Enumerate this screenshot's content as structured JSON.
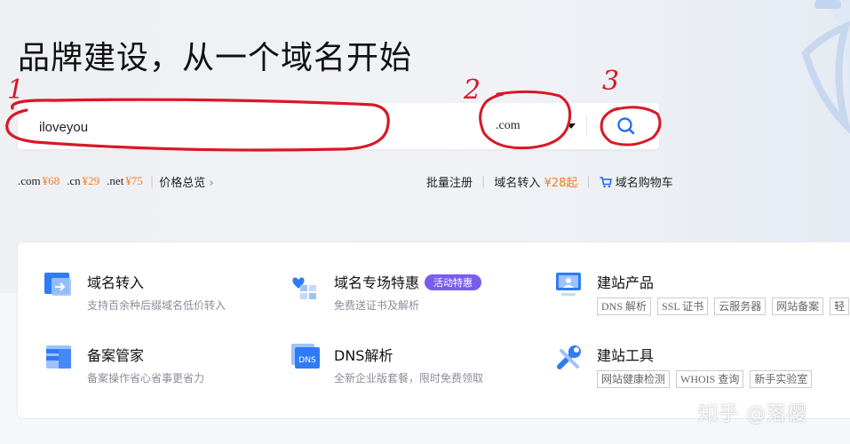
{
  "hero": {
    "title": "品牌建设，从一个域名开始"
  },
  "search": {
    "value": "iloveyou",
    "tld": ".com"
  },
  "annotations": [
    "1",
    "2",
    "3"
  ],
  "prices": [
    {
      "tld": ".com",
      "amount": "¥68"
    },
    {
      "tld": ".cn",
      "amount": "¥29"
    },
    {
      "tld": ".net",
      "amount": "¥75"
    }
  ],
  "price_overview": "价格总览",
  "links": {
    "bulk": "批量注册",
    "transfer": "域名转入",
    "transfer_price": "¥28起",
    "cart": "域名购物车"
  },
  "services": {
    "transfer": {
      "title": "域名转入",
      "desc": "支持百余种后缀域名低价转入"
    },
    "special": {
      "title": "域名专场特惠",
      "badge": "活动特惠",
      "desc": "免费送证书及解析"
    },
    "build": {
      "title": "建站产品",
      "tags": [
        "DNS 解析",
        "SSL 证书",
        "云服务器",
        "网站备案",
        "轻"
      ]
    },
    "beian": {
      "title": "备案管家",
      "desc": "备案操作省心省事更省力"
    },
    "dns": {
      "title": "DNS解析",
      "desc": "全新企业版套餐，限时免费领取",
      "icon_text": "DNS"
    },
    "tools": {
      "title": "建站工具",
      "tags": [
        "网站健康检测",
        "WHOIS 查询",
        "新手实验室"
      ]
    }
  },
  "watermark": "知乎 @落樱",
  "colors": {
    "accent": "#1a66ff",
    "price": "#f07d2a",
    "annotation": "#d81826",
    "badge": "#7a5cf0"
  }
}
